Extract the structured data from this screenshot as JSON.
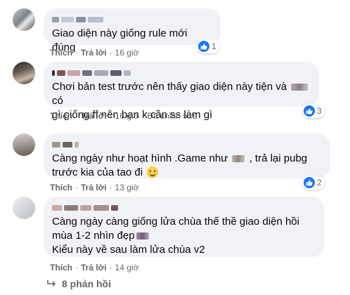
{
  "comments": [
    {
      "text": "Giao diện này giống rule mới đúng",
      "like_label": "Thích",
      "reply_label": "Trả lời",
      "time": "16 giờ",
      "edited": "",
      "reaction_count": "1"
    },
    {
      "text_part1": "Chơi bản test trước nên thấy giao diện này tiện và ",
      "text_part2": " có",
      "text_line2": "gì giống ff nên bạn k cần ss làm gì",
      "like_label": "Thích",
      "reply_label": "Trả lời",
      "time": "16 giờ",
      "edited": "Đã chỉnh sửa",
      "reaction_count": "3"
    },
    {
      "text_part1": "Càng ngày như hoạt hình .Game như ",
      "text_part2": " , trả lại pubg",
      "text_line2": "trước kia của tao đi ",
      "like_label": "Thích",
      "reply_label": "Trả lời",
      "time": "13 giờ",
      "edited": "",
      "reaction_count": "2"
    },
    {
      "text_line1": "Càng ngày càng giống lửa chùa thế thề giao diện hồi",
      "text_line2": "mùa 1-2 nhìn đẹp",
      "text_line3": "Kiểu này về sau làm lửa chùa v2",
      "like_label": "Thích",
      "reply_label": "Trả lời",
      "time": "14 giờ",
      "edited": ""
    }
  ],
  "more_replies": "8 phản hồi",
  "separator": "·",
  "colors": {
    "bubble": "#f0f2f5",
    "like_blue": "#1877f2",
    "meta_gray": "#65676b"
  }
}
